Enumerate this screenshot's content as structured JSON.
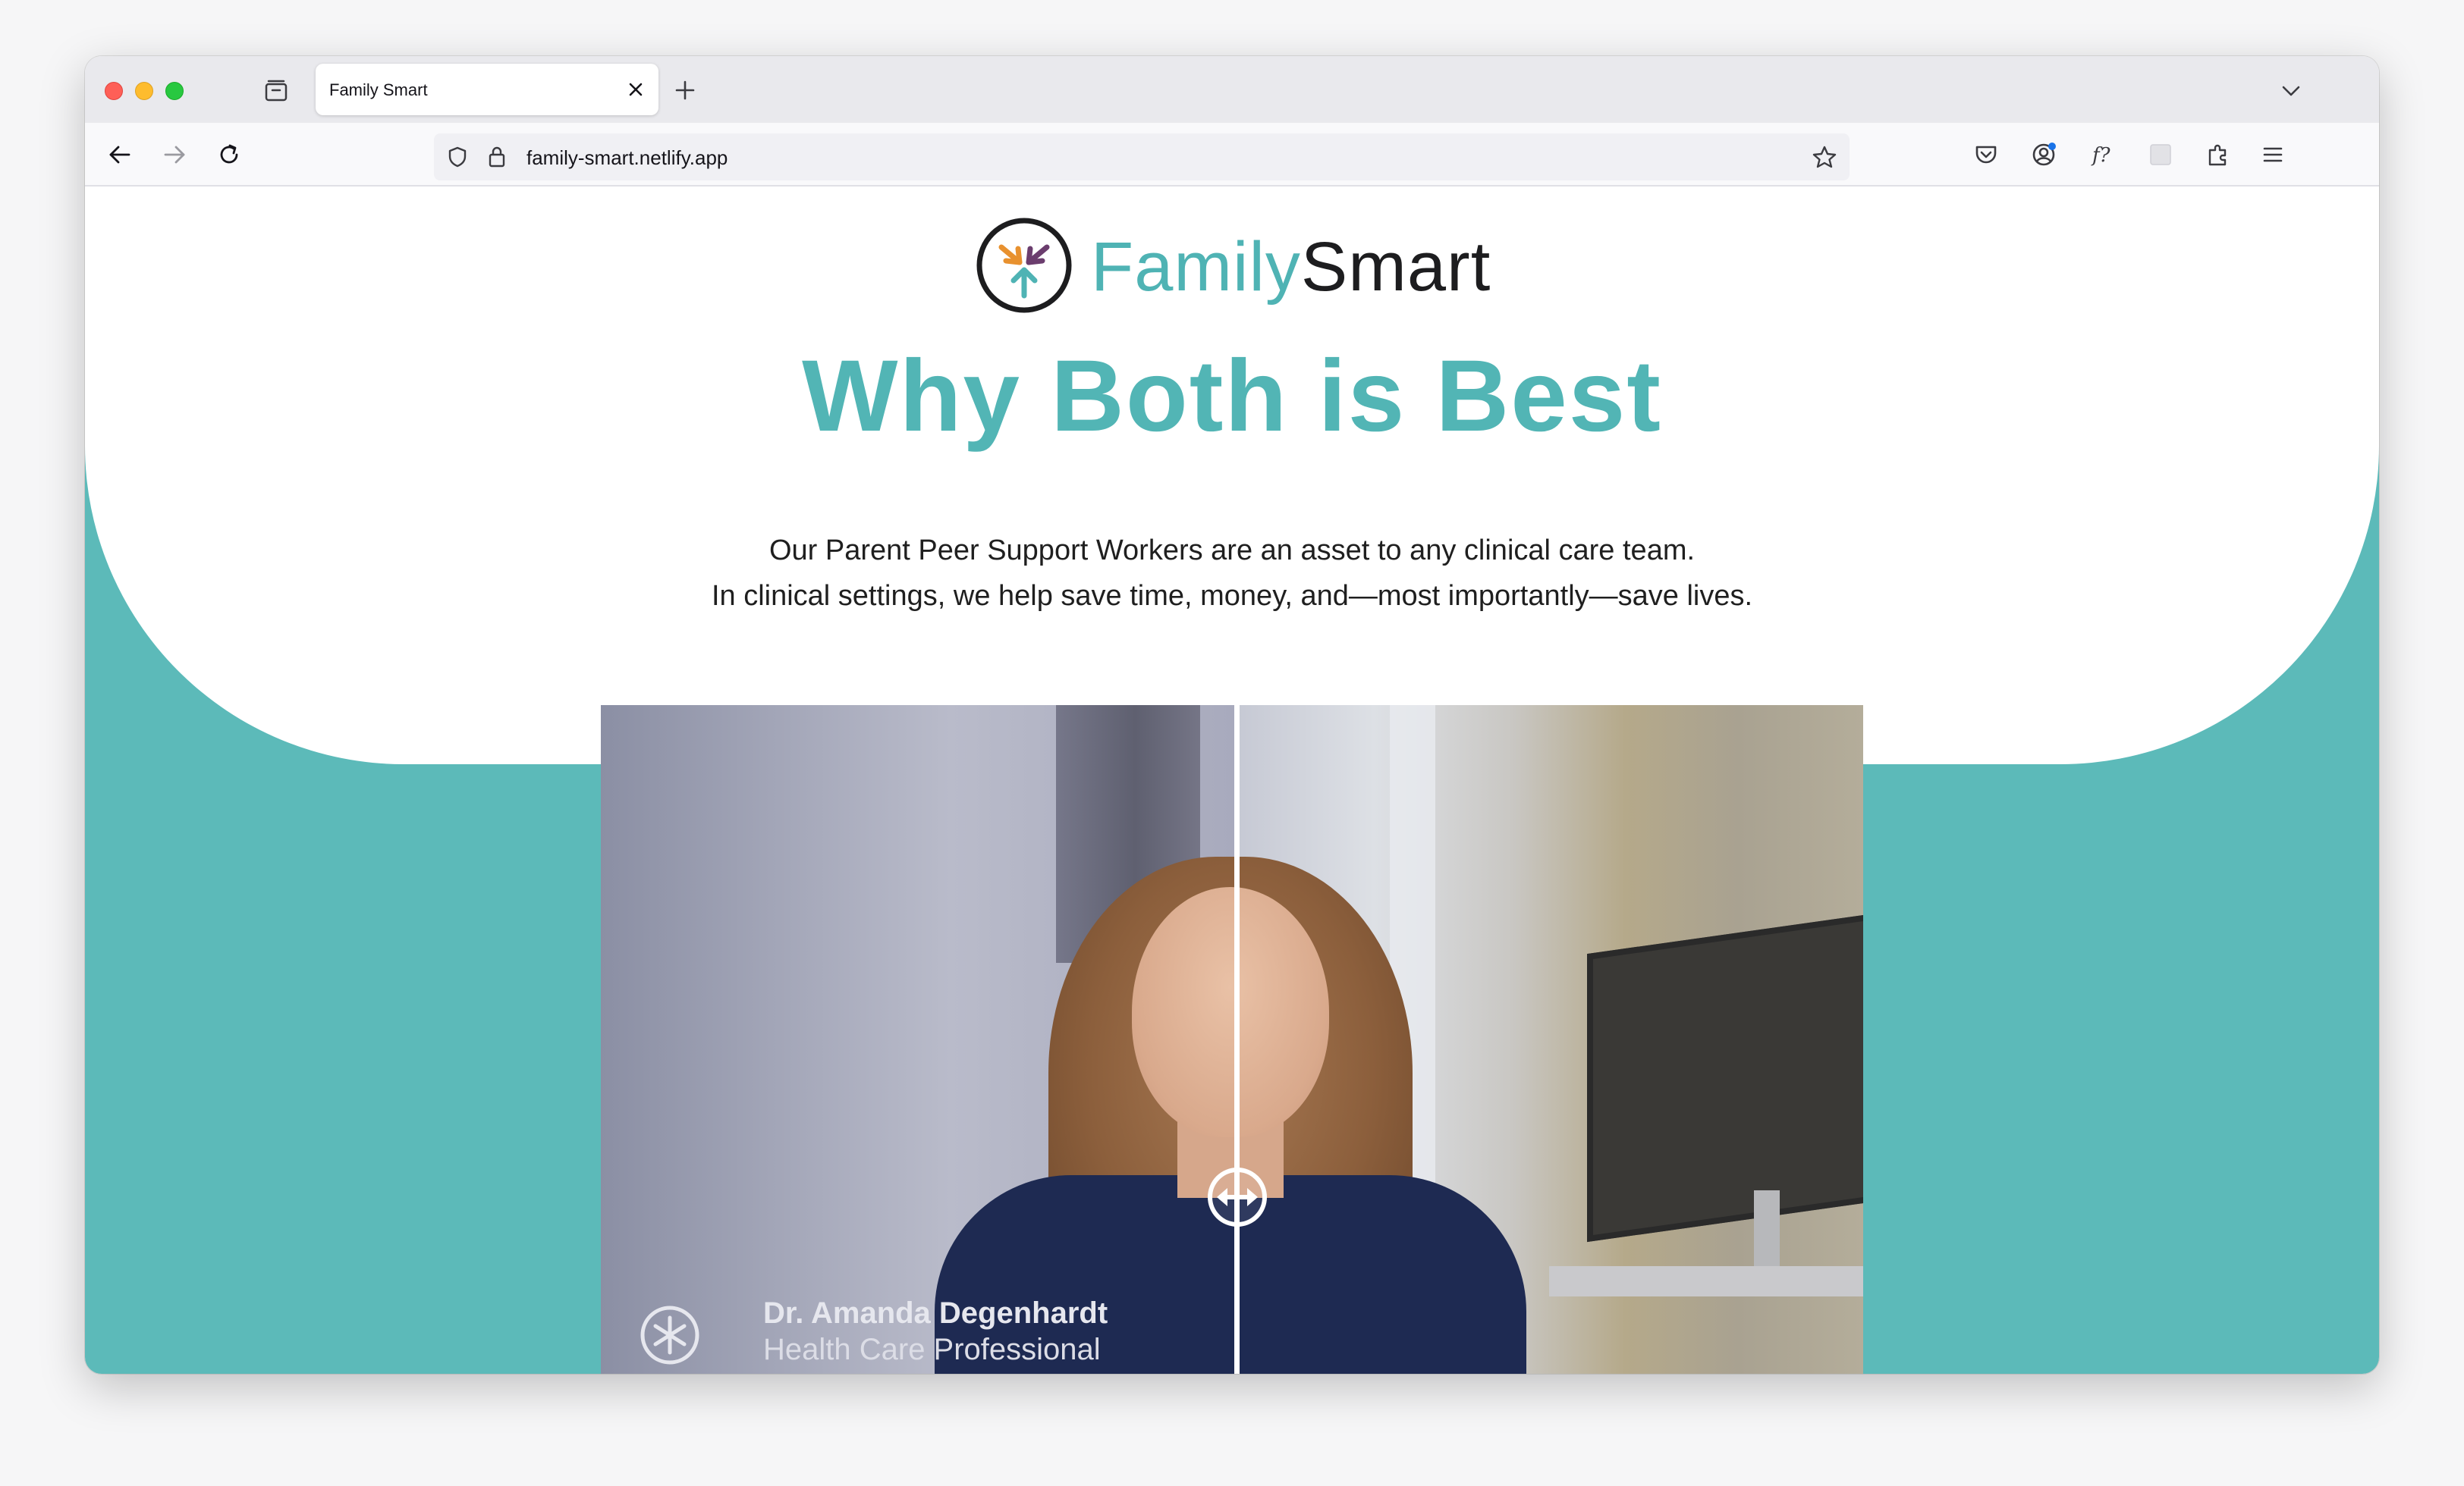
{
  "browser": {
    "tab_title": "Family Smart",
    "url": "family-smart.netlify.app",
    "icons": {
      "tabs": "tab-overview-icon",
      "close": "close-icon",
      "new_tab": "plus-icon",
      "tab_list": "chevron-down-icon",
      "back": "back-arrow-icon",
      "forward": "forward-arrow-icon",
      "reload": "reload-icon",
      "shield": "shield-icon",
      "lock": "lock-icon",
      "bookmark": "star-icon",
      "pocket": "pocket-icon",
      "account": "account-icon",
      "font": "font-icon",
      "extension_blank": "extension-blank-icon",
      "extensions": "puzzle-icon",
      "menu": "hamburger-menu-icon"
    }
  },
  "page": {
    "logo": {
      "text_family": "Family",
      "text_smart": "Smart",
      "colors": {
        "teal": "#4fb3b4",
        "orange": "#e8912f",
        "purple": "#6b3d6e",
        "dark": "#1d1d1f"
      }
    },
    "headline": "Why Both is Best",
    "intro_line_1": "Our Parent Peer Support Workers are an asset to any clinical care team.",
    "intro_line_2": "In clinical settings, we help save time, money, and—most importantly—save lives.",
    "colors": {
      "accent": "#52b5b5",
      "band": "#5cbab9"
    },
    "video": {
      "caption_name": "Dr. Amanda Degenhardt",
      "caption_role": "Health Care Professional",
      "slider_icon": "compare-slider-icon"
    }
  }
}
